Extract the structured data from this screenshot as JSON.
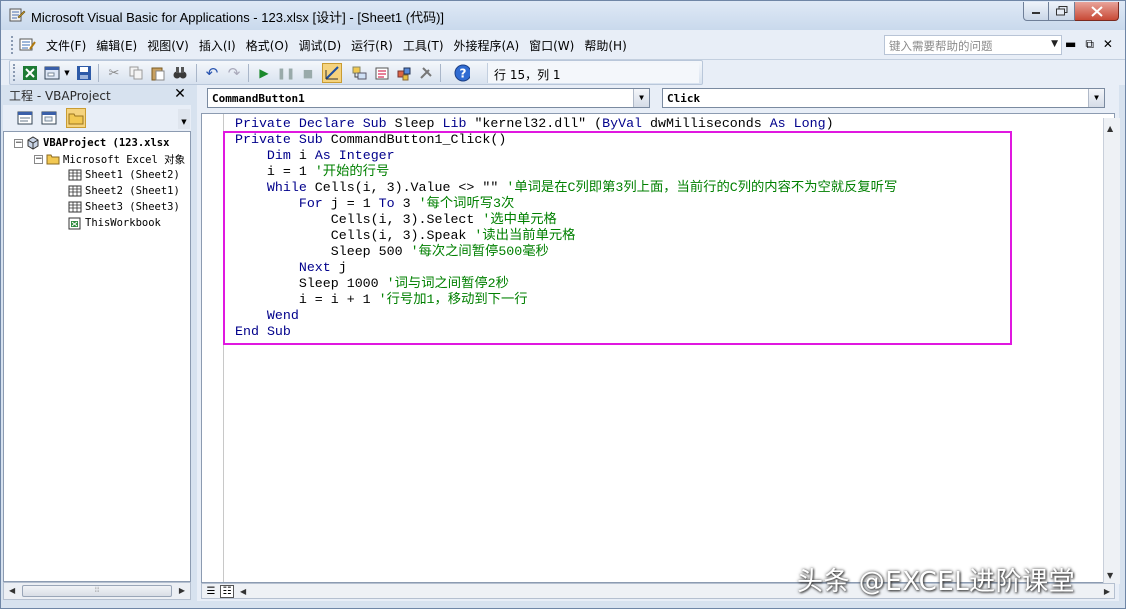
{
  "window": {
    "title": "Microsoft Visual Basic for Applications - 123.xlsx [设计] - [Sheet1 (代码)]"
  },
  "menu": {
    "items": [
      {
        "id": "file",
        "label": "文件(F)"
      },
      {
        "id": "edit",
        "label": "编辑(E)"
      },
      {
        "id": "view",
        "label": "视图(V)"
      },
      {
        "id": "insert",
        "label": "插入(I)"
      },
      {
        "id": "format",
        "label": "格式(O)"
      },
      {
        "id": "debug",
        "label": "调试(D)"
      },
      {
        "id": "run",
        "label": "运行(R)"
      },
      {
        "id": "tools",
        "label": "工具(T)"
      },
      {
        "id": "addins",
        "label": "外接程序(A)"
      },
      {
        "id": "window",
        "label": "窗口(W)"
      },
      {
        "id": "help",
        "label": "帮助(H)"
      }
    ],
    "help_placeholder": "键入需要帮助的问题"
  },
  "toolbar": {
    "cursor_position": "行 15，列 1"
  },
  "project": {
    "title": "工程 - VBAProject",
    "tree": [
      {
        "label": "VBAProject (123.xlsx",
        "bold": true
      },
      {
        "label": "Microsoft Excel 对象",
        "bold": false
      },
      {
        "label": "Sheet1 (Sheet2)",
        "bold": false
      },
      {
        "label": "Sheet2 (Sheet1)",
        "bold": false
      },
      {
        "label": "Sheet3 (Sheet3)",
        "bold": false
      },
      {
        "label": "ThisWorkbook",
        "bold": false
      }
    ]
  },
  "code_window": {
    "object_combo": "CommandButton1",
    "procedure_combo": "Click",
    "lines": [
      {
        "indent": "",
        "code": "Private Declare Sub Sleep Lib \"kernel32.dll\" (ByVal dwMilliseconds As Long)",
        "comment": ""
      },
      {
        "indent": "",
        "code": "Private Sub CommandButton1_Click()",
        "comment": ""
      },
      {
        "indent": "    ",
        "code": "Dim i As Integer",
        "comment": ""
      },
      {
        "indent": "    ",
        "code": "i = 1 ",
        "comment": "'开始的行号"
      },
      {
        "indent": "    ",
        "code": "While Cells(i, 3).Value <> \"\" ",
        "comment": "'单词是在C列即第3列上面，当前行的C列的内容不为空就反复听写"
      },
      {
        "indent": "        ",
        "code": "For j = 1 To 3 ",
        "comment": "'每个词听写3次"
      },
      {
        "indent": "            ",
        "code": "Cells(i, 3).Select ",
        "comment": "'选中单元格"
      },
      {
        "indent": "            ",
        "code": "Cells(i, 3).Speak ",
        "comment": "'读出当前单元格"
      },
      {
        "indent": "            ",
        "code": "Sleep 500 ",
        "comment": "'每次之间暂停500毫秒"
      },
      {
        "indent": "        ",
        "code": "Next j",
        "comment": ""
      },
      {
        "indent": "        ",
        "code": "Sleep 1000 ",
        "comment": "'词与词之间暂停2秒"
      },
      {
        "indent": "        ",
        "code": "i = i + 1 ",
        "comment": "'行号加1，移动到下一行"
      },
      {
        "indent": "    ",
        "code": "Wend",
        "comment": ""
      },
      {
        "indent": "",
        "code": "End Sub",
        "comment": ""
      }
    ]
  },
  "watermark": "头条 @EXCEL进阶课堂",
  "colors": {
    "keyword": "#00008b",
    "comment": "#008000",
    "highlight": "#e018e0"
  }
}
